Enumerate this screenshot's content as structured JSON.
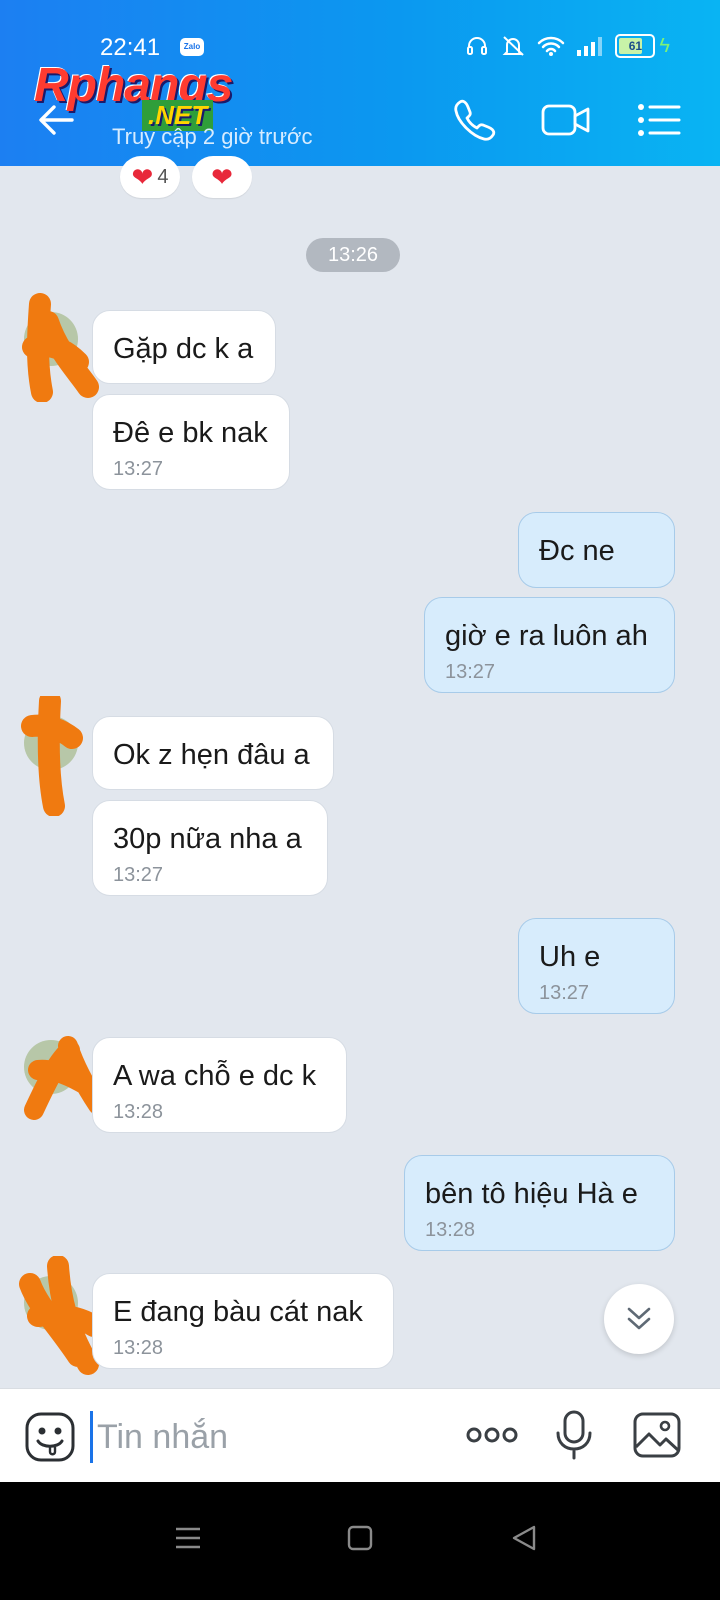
{
  "status_bar": {
    "time": "22:41",
    "app_badge": "Zalo",
    "battery": "61"
  },
  "header": {
    "watermark_main": "Rphangs",
    "watermark_sub": ".NET",
    "last_seen": "Truy cập 2 giờ trước"
  },
  "reactions": [
    {
      "emoji": "❤",
      "count": "4"
    },
    {
      "emoji": "❤",
      "count": ""
    }
  ],
  "timestamp_separator": "13:26",
  "messages": [
    {
      "dir": "in",
      "text": "Gặp dc k a",
      "time": ""
    },
    {
      "dir": "in",
      "text": "Đê e bk nak",
      "time": "13:27"
    },
    {
      "dir": "out",
      "text": "Đc ne",
      "time": ""
    },
    {
      "dir": "out",
      "text": "giờ e ra luôn ah",
      "time": "13:27"
    },
    {
      "dir": "in",
      "text": "Ok z hẹn đâu a",
      "time": ""
    },
    {
      "dir": "in",
      "text": "30p nữa nha a",
      "time": "13:27"
    },
    {
      "dir": "out",
      "text": "Uh e",
      "time": "13:27"
    },
    {
      "dir": "in",
      "text": "A wa chỗ e dc k",
      "time": "13:28"
    },
    {
      "dir": "out",
      "text": "bên tô hiệu Hà e",
      "time": "13:28"
    },
    {
      "dir": "in",
      "text": "E đang bàu cát nak",
      "time": "13:28"
    }
  ],
  "input": {
    "placeholder": "Tin nhắn"
  },
  "colors": {
    "header_start": "#1c7ff2",
    "header_end": "#09b4f3",
    "incoming_bubble": "#ffffff",
    "outgoing_bubble": "#d7ecfc",
    "chat_background": "#e2e7ee"
  },
  "icons": {
    "back": "arrow-left-icon",
    "call": "phone-icon",
    "video": "video-camera-icon",
    "menu": "list-menu-icon",
    "scroll": "double-chevron-down-icon",
    "sticker": "smiley-sticker-icon",
    "more": "ellipsis-icon",
    "mic": "microphone-icon",
    "image": "image-gallery-icon"
  }
}
